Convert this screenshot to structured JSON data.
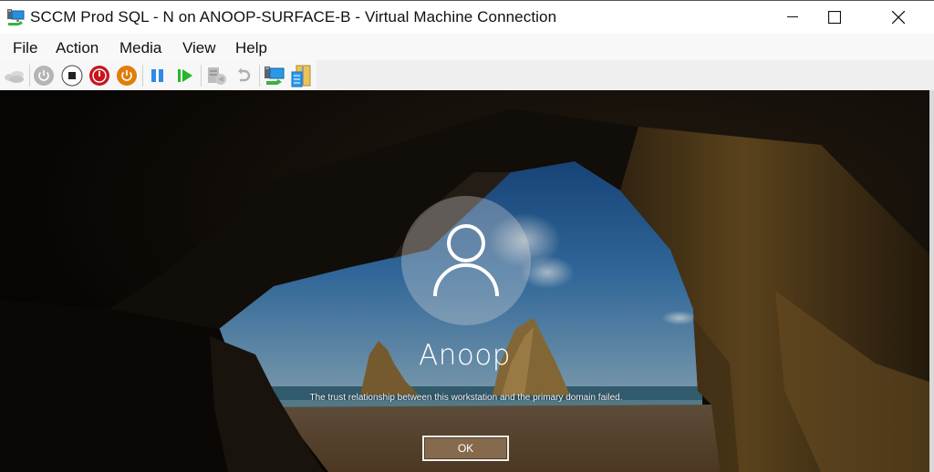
{
  "window": {
    "title": "SCCM Prod SQL - N on ANOOP-SURFACE-B - Virtual Machine Connection",
    "icon": "vm-connection-icon",
    "controls": [
      "minimize-icon",
      "maximize-icon",
      "close-icon"
    ]
  },
  "menubar": {
    "items": [
      {
        "label": "File"
      },
      {
        "label": "Action"
      },
      {
        "label": "Media"
      },
      {
        "label": "View"
      },
      {
        "label": "Help"
      }
    ]
  },
  "toolbar": {
    "buttons": [
      {
        "name": "ctrl-alt-del",
        "icon": "keyboard-keys-icon",
        "enabled": false
      },
      {
        "name": "start",
        "icon": "power-gray-icon",
        "enabled": false
      },
      {
        "name": "turn-off",
        "icon": "stop-square-icon",
        "enabled": true
      },
      {
        "name": "shut-down",
        "icon": "power-red-icon",
        "enabled": true
      },
      {
        "name": "save",
        "icon": "power-orange-icon",
        "enabled": true
      },
      {
        "name": "pause",
        "icon": "pause-icon",
        "enabled": true
      },
      {
        "name": "reset",
        "icon": "play-reset-icon",
        "enabled": true
      },
      {
        "name": "checkpoint",
        "icon": "checkpoint-icon",
        "enabled": false
      },
      {
        "name": "revert",
        "icon": "revert-icon",
        "enabled": false
      },
      {
        "name": "enhanced-session",
        "icon": "enhanced-session-icon",
        "enabled": true
      },
      {
        "name": "share",
        "icon": "share-icon",
        "enabled": true
      }
    ],
    "colors": {
      "disabled": "#b5b5b5",
      "red": "#c8141e",
      "orange": "#e37d0a",
      "blue": "#2e8ae6",
      "green": "#26b52c"
    }
  },
  "vm_screen": {
    "user": {
      "avatar_icon": "user-icon",
      "name": "Anoop"
    },
    "message": "The trust relationship between this workstation and the primary domain failed.",
    "ok_button": "OK",
    "colors": {
      "sky": "#2f6ea8",
      "sand": "#8a6a40",
      "rock": "#6b4e22",
      "button_bg": "#8b6e50"
    }
  }
}
